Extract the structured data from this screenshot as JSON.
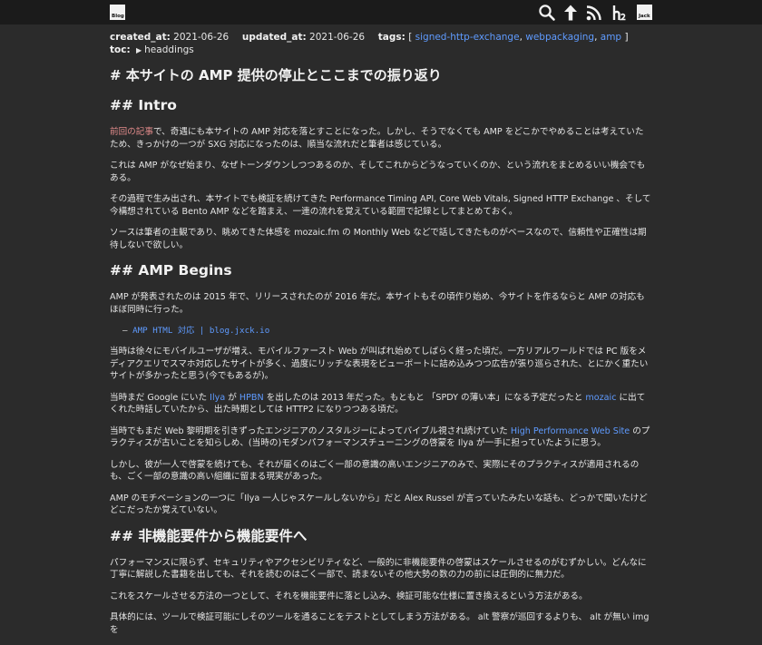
{
  "header": {
    "blog_logo": "Blog",
    "jack_logo": "Jack",
    "icons": [
      "search-icon",
      "arrow-up-icon",
      "rss-icon",
      "h2-icon"
    ]
  },
  "meta": {
    "created_label": "created_at:",
    "created_value": "2021-06-26",
    "updated_label": "updated_at:",
    "updated_value": "2021-06-26",
    "tags_label": "tags:",
    "tags_open": "[",
    "tags": [
      "signed-http-exchange",
      "webpackaging",
      "amp"
    ],
    "tags_close": "]",
    "sep": ",",
    "toc_label": "toc:",
    "toc_arrow": "▶",
    "toc_value": "headdings"
  },
  "article": {
    "title": "# 本サイトの AMP 提供の停止とここまでの振り返り",
    "intro_heading": "## Intro",
    "p1_link": "前回の記事",
    "p1_rest": "で、奇遇にも本サイトの AMP 対応を落とすことになった。しかし、そうでなくても AMP をどこかでやめることは考えていたため、きっかけの一つが SXG 対応になったのは、順当な流れだと筆者は感じている。",
    "p2": "これは AMP がなぜ始まり、なぜトーンダウンしつつあるのか、そしてこれからどうなっていくのか、という流れをまとめるいい機会でもある。",
    "p3": "その過程で生み出され、本サイトでも検証を続けてきた Performance Timing API, Core Web Vitals, Signed HTTP Exchange 、そして今構想されている Bento AMP などを踏まえ、一連の流れを覚えている範囲で記録としてまとめておく。",
    "p4": "ソースは筆者の主観であり、眺めてきた体感を mozaic.fm の Monthly Web などで話してきたものがベースなので、信頼性や正確性は期待しないで欲しい。",
    "begins_heading": "## AMP Begins",
    "p5": "AMP が発表されたのは 2015 年で、リリースされたのが 2016 年だ。本サイトもその頃作り始め、今サイトを作るならと AMP の対応もほぼ同時に行った。",
    "code_dash": "–",
    "code_link": "AMP HTML 対応 | blog.jxck.io",
    "p6": "当時は徐々にモバイルユーザが増え、モバイルファースト Web が叫ばれ始めてしばらく経った頃だ。一方リアルワールドでは PC 版をメディアクエリでスマホ対応したサイトが多く、過度にリッチな表現をビューポートに詰め込みつつ広告が張り巡らされた、とにかく重たいサイトが多かったと思う(今でもあるが)。",
    "p7_a": "当時まだ Google にいた ",
    "p7_link1": "Ilya",
    "p7_b": " が ",
    "p7_link2": "HPBN",
    "p7_c": " を出したのは 2013 年だった。もともと 「SPDY の薄い本」になる予定だったと ",
    "p7_link3": "mozaic",
    "p7_d": " に出てくれた時話していたから、出た時期としては HTTP2 になりつつある頃だ。",
    "p8_a": "当時でもまだ Web 黎明期を引きずったエンジニアのノスタルジーによってバイブル視され続けていた ",
    "p8_link": "High Performance Web Site",
    "p8_b": " のプラクティスが古いことを知らしめ、(当時の)モダンパフォーマンスチューニングの啓蒙を Ilya が一手に担っていたように思う。",
    "p9": "しかし、彼が一人で啓蒙を続けても、それが届くのはごく一部の意識の高いエンジニアのみで、実際にそのプラクティスが適用されるのも、ごく一部の意識の高い組織に留まる現実があった。",
    "p10": "AMP のモチベーションの一つに「Ilya 一人じゃスケールしないから」だと Alex Russel が言っていたみたいな話も、どっかで聞いたけどどこだったか覚えていない。",
    "nfr_heading": "## 非機能要件から機能要件へ",
    "p11": "パフォーマンスに限らず、セキュリティやアクセシビリティなど、一般的に非機能要件の啓蒙はスケールさせるのがむずかしい。どんなに丁寧に解説した書籍を出しても、それを読むのはごく一部で、読まないその他大勢の数の力の前には圧倒的に無力だ。",
    "p12": "これをスケールさせる方法の一つとして、それを機能要件に落とし込み、検証可能な仕様に置き換えるという方法がある。",
    "p13": "具体的には、ツールで検証可能にしそのツールを通ることをテストとしてしまう方法がある。 alt 警察が巡回するよりも、 alt が無い img を"
  }
}
